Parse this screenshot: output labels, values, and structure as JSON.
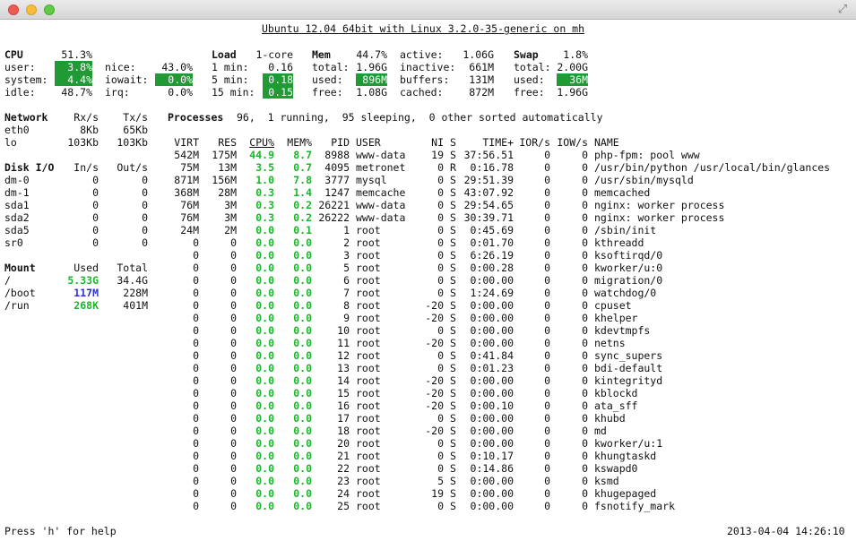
{
  "header": {
    "title": "Ubuntu 12.04 64bit with Linux 3.2.0-35-generic on mh"
  },
  "window": {
    "fullscreen_icon": "fullscreen-arrows-icon"
  },
  "colors": {
    "highlight_bg": "#1f9a35",
    "ok_text": "#1bb52b",
    "careful_text": "#2d2fcf"
  },
  "cpu": {
    "title": "CPU",
    "total": "51.3%",
    "user_label": "user:",
    "user": "3.8%",
    "system_label": "system:",
    "system": "4.4%",
    "idle_label": "idle:",
    "idle": "48.7%",
    "nice_label": "nice:",
    "nice": "43.0%",
    "iowait_label": "iowait:",
    "iowait": "0.0%",
    "irq_label": "irq:",
    "irq": "0.0%"
  },
  "load": {
    "title": "Load",
    "cores": "1-core",
    "min1_label": "1 min:",
    "min1": "0.16",
    "min5_label": "5 min:",
    "min5": "0.18",
    "min15_label": "15 min:",
    "min15": "0.15"
  },
  "mem": {
    "title": "Mem",
    "percent": "44.7%",
    "total_label": "total:",
    "total": "1.96G",
    "used_label": "used:",
    "used": "896M",
    "free_label": "free:",
    "free": "1.08G",
    "active_label": "active:",
    "active": "1.06G",
    "inactive_label": "inactive:",
    "inactive": "661M",
    "buffers_label": "buffers:",
    "buffers": "131M",
    "cached_label": "cached:",
    "cached": "872M"
  },
  "swap": {
    "title": "Swap",
    "percent": "1.8%",
    "total_label": "total:",
    "total": "2.00G",
    "used_label": "used:",
    "used": "36M",
    "free_label": "free:",
    "free": "1.96G"
  },
  "network": {
    "title": "Network",
    "rx_header": "Rx/s",
    "tx_header": "Tx/s",
    "rows": [
      {
        "name": "eth0",
        "rx": "8Kb",
        "tx": "65Kb"
      },
      {
        "name": "lo",
        "rx": "103Kb",
        "tx": "103Kb"
      }
    ]
  },
  "disk": {
    "title": "Disk I/O",
    "in_header": "In/s",
    "out_header": "Out/s",
    "rows": [
      {
        "name": "dm-0",
        "in": "0",
        "out": "0"
      },
      {
        "name": "dm-1",
        "in": "0",
        "out": "0"
      },
      {
        "name": "sda1",
        "in": "0",
        "out": "0"
      },
      {
        "name": "sda2",
        "in": "0",
        "out": "0"
      },
      {
        "name": "sda5",
        "in": "0",
        "out": "0"
      },
      {
        "name": "sr0",
        "in": "0",
        "out": "0"
      }
    ]
  },
  "mounts": {
    "title": "Mount",
    "used_header": "Used",
    "total_header": "Total",
    "rows": [
      {
        "name": "/",
        "used": "5.33G",
        "total": "34.4G",
        "state": "ok"
      },
      {
        "name": "/boot",
        "used": "117M",
        "total": "228M",
        "state": "careful"
      },
      {
        "name": "/run",
        "used": "268K",
        "total": "401M",
        "state": "ok"
      }
    ]
  },
  "processes": {
    "summary_title": "Processes",
    "summary": "96,  1 running,  95 sleeping,  0 other sorted automatically",
    "headers": {
      "virt": "VIRT",
      "res": "RES",
      "cpu": "CPU%",
      "mem": "MEM%",
      "pid": "PID",
      "user": "USER",
      "ni": "NI",
      "s": "S",
      "time": "TIME+",
      "ior": "IOR/s",
      "iow": "IOW/s",
      "name": "NAME"
    },
    "rows": [
      {
        "virt": "542M",
        "res": "175M",
        "cpu": "44.9",
        "mem": "8.7",
        "pid": "8988",
        "user": "www-data",
        "ni": "19",
        "s": "S",
        "time": "37:56.51",
        "ior": "0",
        "iow": "0",
        "name": "php-fpm: pool www"
      },
      {
        "virt": "75M",
        "res": "13M",
        "cpu": "3.5",
        "mem": "0.7",
        "pid": "4095",
        "user": "metronet",
        "ni": "0",
        "s": "R",
        "time": "0:16.78",
        "ior": "0",
        "iow": "0",
        "name": "/usr/bin/python /usr/local/bin/glances"
      },
      {
        "virt": "871M",
        "res": "156M",
        "cpu": "1.0",
        "mem": "7.8",
        "pid": "3777",
        "user": "mysql",
        "ni": "0",
        "s": "S",
        "time": "29:51.39",
        "ior": "0",
        "iow": "0",
        "name": "/usr/sbin/mysqld"
      },
      {
        "virt": "368M",
        "res": "28M",
        "cpu": "0.3",
        "mem": "1.4",
        "pid": "1247",
        "user": "memcache",
        "ni": "0",
        "s": "S",
        "time": "43:07.92",
        "ior": "0",
        "iow": "0",
        "name": "memcached"
      },
      {
        "virt": "76M",
        "res": "3M",
        "cpu": "0.3",
        "mem": "0.2",
        "pid": "26221",
        "user": "www-data",
        "ni": "0",
        "s": "S",
        "time": "29:54.65",
        "ior": "0",
        "iow": "0",
        "name": "nginx: worker process"
      },
      {
        "virt": "76M",
        "res": "3M",
        "cpu": "0.3",
        "mem": "0.2",
        "pid": "26222",
        "user": "www-data",
        "ni": "0",
        "s": "S",
        "time": "30:39.71",
        "ior": "0",
        "iow": "0",
        "name": "nginx: worker process"
      },
      {
        "virt": "24M",
        "res": "2M",
        "cpu": "0.0",
        "mem": "0.1",
        "pid": "1",
        "user": "root",
        "ni": "0",
        "s": "S",
        "time": "0:45.69",
        "ior": "0",
        "iow": "0",
        "name": "/sbin/init"
      },
      {
        "virt": "0",
        "res": "0",
        "cpu": "0.0",
        "mem": "0.0",
        "pid": "2",
        "user": "root",
        "ni": "0",
        "s": "S",
        "time": "0:01.70",
        "ior": "0",
        "iow": "0",
        "name": "kthreadd"
      },
      {
        "virt": "0",
        "res": "0",
        "cpu": "0.0",
        "mem": "0.0",
        "pid": "3",
        "user": "root",
        "ni": "0",
        "s": "S",
        "time": "6:26.19",
        "ior": "0",
        "iow": "0",
        "name": "ksoftirqd/0"
      },
      {
        "virt": "0",
        "res": "0",
        "cpu": "0.0",
        "mem": "0.0",
        "pid": "5",
        "user": "root",
        "ni": "0",
        "s": "S",
        "time": "0:00.28",
        "ior": "0",
        "iow": "0",
        "name": "kworker/u:0"
      },
      {
        "virt": "0",
        "res": "0",
        "cpu": "0.0",
        "mem": "0.0",
        "pid": "6",
        "user": "root",
        "ni": "0",
        "s": "S",
        "time": "0:00.00",
        "ior": "0",
        "iow": "0",
        "name": "migration/0"
      },
      {
        "virt": "0",
        "res": "0",
        "cpu": "0.0",
        "mem": "0.0",
        "pid": "7",
        "user": "root",
        "ni": "0",
        "s": "S",
        "time": "1:24.69",
        "ior": "0",
        "iow": "0",
        "name": "watchdog/0"
      },
      {
        "virt": "0",
        "res": "0",
        "cpu": "0.0",
        "mem": "0.0",
        "pid": "8",
        "user": "root",
        "ni": "-20",
        "s": "S",
        "time": "0:00.00",
        "ior": "0",
        "iow": "0",
        "name": "cpuset"
      },
      {
        "virt": "0",
        "res": "0",
        "cpu": "0.0",
        "mem": "0.0",
        "pid": "9",
        "user": "root",
        "ni": "-20",
        "s": "S",
        "time": "0:00.00",
        "ior": "0",
        "iow": "0",
        "name": "khelper"
      },
      {
        "virt": "0",
        "res": "0",
        "cpu": "0.0",
        "mem": "0.0",
        "pid": "10",
        "user": "root",
        "ni": "0",
        "s": "S",
        "time": "0:00.00",
        "ior": "0",
        "iow": "0",
        "name": "kdevtmpfs"
      },
      {
        "virt": "0",
        "res": "0",
        "cpu": "0.0",
        "mem": "0.0",
        "pid": "11",
        "user": "root",
        "ni": "-20",
        "s": "S",
        "time": "0:00.00",
        "ior": "0",
        "iow": "0",
        "name": "netns"
      },
      {
        "virt": "0",
        "res": "0",
        "cpu": "0.0",
        "mem": "0.0",
        "pid": "12",
        "user": "root",
        "ni": "0",
        "s": "S",
        "time": "0:41.84",
        "ior": "0",
        "iow": "0",
        "name": "sync_supers"
      },
      {
        "virt": "0",
        "res": "0",
        "cpu": "0.0",
        "mem": "0.0",
        "pid": "13",
        "user": "root",
        "ni": "0",
        "s": "S",
        "time": "0:01.23",
        "ior": "0",
        "iow": "0",
        "name": "bdi-default"
      },
      {
        "virt": "0",
        "res": "0",
        "cpu": "0.0",
        "mem": "0.0",
        "pid": "14",
        "user": "root",
        "ni": "-20",
        "s": "S",
        "time": "0:00.00",
        "ior": "0",
        "iow": "0",
        "name": "kintegrityd"
      },
      {
        "virt": "0",
        "res": "0",
        "cpu": "0.0",
        "mem": "0.0",
        "pid": "15",
        "user": "root",
        "ni": "-20",
        "s": "S",
        "time": "0:00.00",
        "ior": "0",
        "iow": "0",
        "name": "kblockd"
      },
      {
        "virt": "0",
        "res": "0",
        "cpu": "0.0",
        "mem": "0.0",
        "pid": "16",
        "user": "root",
        "ni": "-20",
        "s": "S",
        "time": "0:00.10",
        "ior": "0",
        "iow": "0",
        "name": "ata_sff"
      },
      {
        "virt": "0",
        "res": "0",
        "cpu": "0.0",
        "mem": "0.0",
        "pid": "17",
        "user": "root",
        "ni": "0",
        "s": "S",
        "time": "0:00.00",
        "ior": "0",
        "iow": "0",
        "name": "khubd"
      },
      {
        "virt": "0",
        "res": "0",
        "cpu": "0.0",
        "mem": "0.0",
        "pid": "18",
        "user": "root",
        "ni": "-20",
        "s": "S",
        "time": "0:00.00",
        "ior": "0",
        "iow": "0",
        "name": "md"
      },
      {
        "virt": "0",
        "res": "0",
        "cpu": "0.0",
        "mem": "0.0",
        "pid": "20",
        "user": "root",
        "ni": "0",
        "s": "S",
        "time": "0:00.00",
        "ior": "0",
        "iow": "0",
        "name": "kworker/u:1"
      },
      {
        "virt": "0",
        "res": "0",
        "cpu": "0.0",
        "mem": "0.0",
        "pid": "21",
        "user": "root",
        "ni": "0",
        "s": "S",
        "time": "0:10.17",
        "ior": "0",
        "iow": "0",
        "name": "khungtaskd"
      },
      {
        "virt": "0",
        "res": "0",
        "cpu": "0.0",
        "mem": "0.0",
        "pid": "22",
        "user": "root",
        "ni": "0",
        "s": "S",
        "time": "0:14.86",
        "ior": "0",
        "iow": "0",
        "name": "kswapd0"
      },
      {
        "virt": "0",
        "res": "0",
        "cpu": "0.0",
        "mem": "0.0",
        "pid": "23",
        "user": "root",
        "ni": "5",
        "s": "S",
        "time": "0:00.00",
        "ior": "0",
        "iow": "0",
        "name": "ksmd"
      },
      {
        "virt": "0",
        "res": "0",
        "cpu": "0.0",
        "mem": "0.0",
        "pid": "24",
        "user": "root",
        "ni": "19",
        "s": "S",
        "time": "0:00.00",
        "ior": "0",
        "iow": "0",
        "name": "khugepaged"
      },
      {
        "virt": "0",
        "res": "0",
        "cpu": "0.0",
        "mem": "0.0",
        "pid": "25",
        "user": "root",
        "ni": "0",
        "s": "S",
        "time": "0:00.00",
        "ior": "0",
        "iow": "0",
        "name": "fsnotify_mark"
      }
    ]
  },
  "footer": {
    "help": "Press 'h' for help",
    "datetime": "2013-04-04 14:26:10"
  }
}
